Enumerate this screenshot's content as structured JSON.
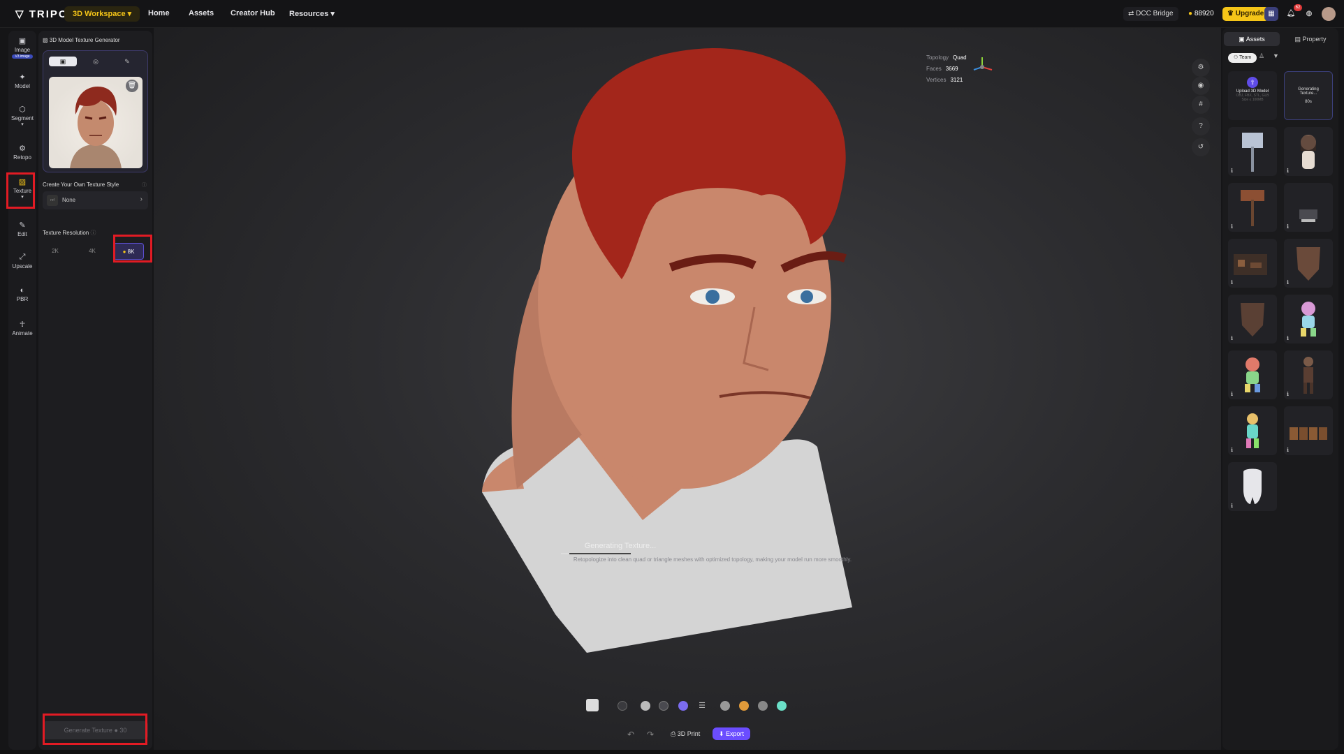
{
  "topbar": {
    "logo": "TRIPO",
    "workspace": "3D Workspace",
    "nav": [
      "Home",
      "Assets",
      "Creator Hub",
      "Resources"
    ],
    "dcc_bridge": "DCC Bridge",
    "credits": "88920",
    "upgrade": "Upgrade",
    "notification_count": "62"
  },
  "left_tools": [
    {
      "label": "Image",
      "sub": "V3 image"
    },
    {
      "label": "Model"
    },
    {
      "label": "Segment"
    },
    {
      "label": "Retopo"
    },
    {
      "label": "Texture"
    },
    {
      "label": "Edit"
    },
    {
      "label": "Upscale"
    },
    {
      "label": "PBR"
    },
    {
      "label": "Animate"
    }
  ],
  "panel": {
    "title": "3D Model Texture Generator",
    "style_heading": "Create Your Own Texture Style",
    "style_value": "None",
    "style_thumb": "ref",
    "resolution_heading": "Texture Resolution",
    "resolutions": [
      "2K",
      "4K",
      "8K"
    ],
    "selected_resolution": "8K",
    "generate_label": "Generate Texture",
    "generate_cost": "30"
  },
  "viewport": {
    "stats": {
      "topology_label": "Topology",
      "topology": "Quad",
      "faces_label": "Faces",
      "faces": "3669",
      "vertices_label": "Vertices",
      "vertices": "3121"
    },
    "status": "Generating Texture...",
    "hint": "Retopologize into clean quad or triangle meshes with optimized topology, making your model run more smoothly.",
    "progress": 0.12,
    "print_label": "3D Print",
    "export_label": "Export"
  },
  "right_panel": {
    "tabs": [
      "Assets",
      "Property"
    ],
    "filter": "Team",
    "upload_title": "Upload 3D Model",
    "upload_formats": "OBJ, FBX, STL, GLB",
    "upload_size": "Size ≤ 100MB",
    "generating_label": "Generating Texture...",
    "generating_time": "80s"
  },
  "colors": {
    "accent": "#6b4dff",
    "gold": "#f5c518",
    "highlight": "#e21b24",
    "hair": "#a3261b",
    "skin": "#c9846a",
    "shirt": "#d6d6d6"
  }
}
